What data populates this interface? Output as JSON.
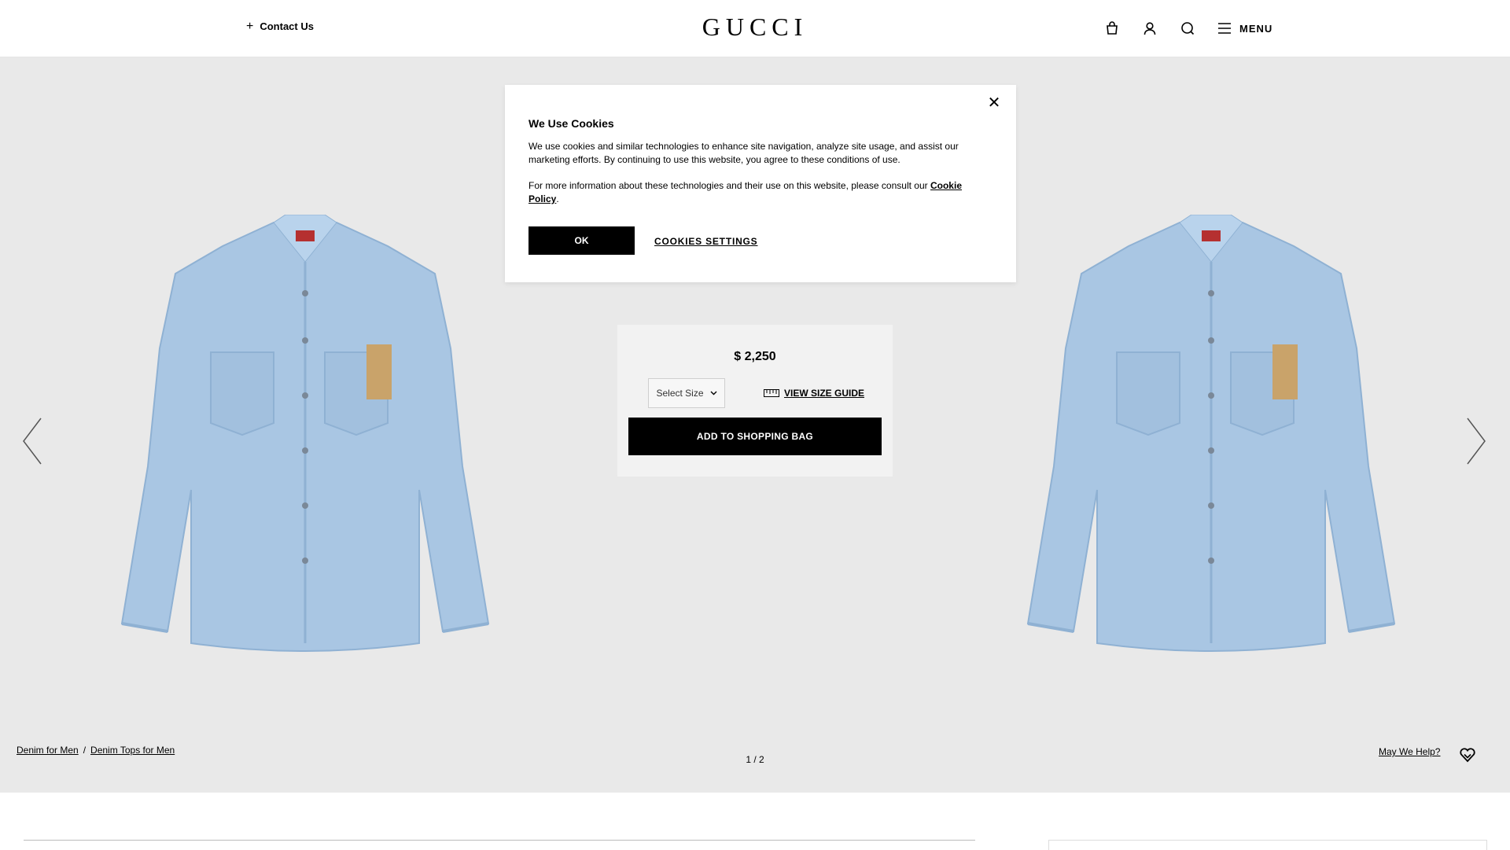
{
  "header": {
    "contact_label": "Contact Us",
    "logo_text": "GUCCI",
    "menu_label": "MENU",
    "icons": [
      "shopping-bag-icon",
      "user-icon",
      "search-icon",
      "hamburger-icon"
    ]
  },
  "product": {
    "price": "$ 2,250",
    "size_select_placeholder": "Select Size",
    "size_guide_label": "VIEW SIZE GUIDE",
    "add_to_bag_label": "ADD TO SHOPPING BAG"
  },
  "breadcrumb": {
    "items": [
      "Denim for Men",
      "Denim Tops for Men"
    ],
    "separator": "/"
  },
  "pager": "1 / 2",
  "help_label": "May We Help?",
  "cookie_modal": {
    "title": "We Use Cookies",
    "paragraph1": "We use cookies and similar technologies to enhance site navigation, analyze site usage, and assist our marketing efforts. By continuing to use this website, you agree to these conditions of use.",
    "paragraph2_prefix": "For more information about these technologies and their use on this website, please consult our",
    "policy_link": "Cookie Policy",
    "paragraph2_suffix": ".",
    "ok_label": "OK",
    "settings_label": "COOKIES SETTINGS"
  },
  "colors": {
    "hero_background": "#e9e9e9",
    "denim": "#aecbe6",
    "button": "#000000"
  }
}
